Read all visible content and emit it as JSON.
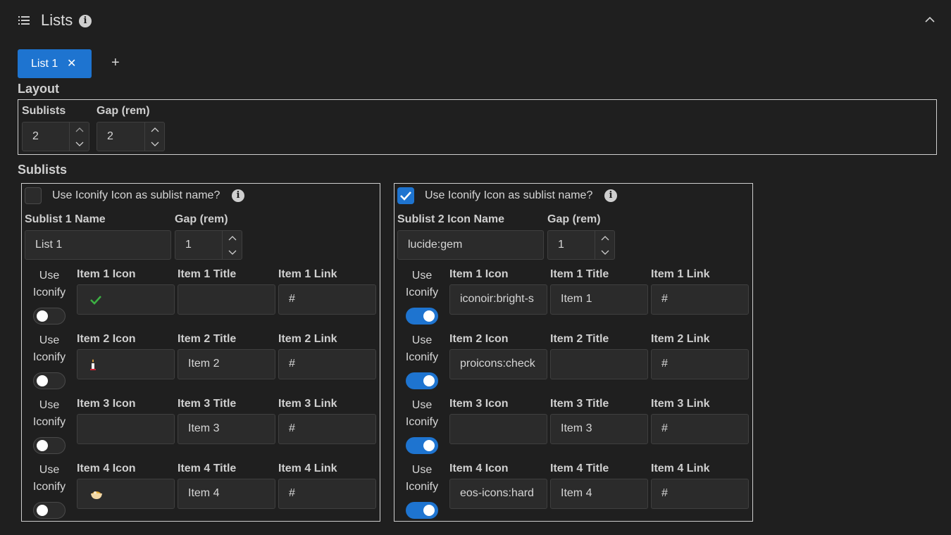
{
  "header": {
    "title": "Lists"
  },
  "tabs": [
    {
      "label": "List 1"
    }
  ],
  "layout": {
    "title": "Layout",
    "sublists_label": "Sublists",
    "sublists_value": "2",
    "gap_label": "Gap (rem)",
    "gap_value": "2"
  },
  "sublists_title": "Sublists",
  "sublists": [
    {
      "checkbox_label": "Use Iconify Icon as sublist name?",
      "checked": false,
      "name_label": "Sublist 1 Name",
      "name_value": "List 1",
      "gap_label": "Gap (rem)",
      "gap_value": "1",
      "items": [
        {
          "use_label_1": "Use",
          "use_label_2": "Iconify",
          "iconify": false,
          "icon_label": "Item 1 Icon",
          "icon_value": "",
          "icon_glyph": "check",
          "title_label": "Item 1 Title",
          "title_value": "",
          "link_label": "Item 1 Link",
          "link_value": "#"
        },
        {
          "use_label_1": "Use",
          "use_label_2": "Iconify",
          "iconify": false,
          "icon_label": "Item 2 Icon",
          "icon_value": "",
          "icon_glyph": "candle",
          "title_label": "Item 2 Title",
          "title_value": "Item 2",
          "link_label": "Item 2 Link",
          "link_value": "#"
        },
        {
          "use_label_1": "Use",
          "use_label_2": "Iconify",
          "iconify": false,
          "icon_label": "Item 3 Icon",
          "icon_value": "",
          "icon_glyph": "",
          "title_label": "Item 3 Title",
          "title_value": "Item 3",
          "link_label": "Item 3 Link",
          "link_value": "#"
        },
        {
          "use_label_1": "Use",
          "use_label_2": "Iconify",
          "iconify": false,
          "icon_label": "Item 4 Icon",
          "icon_value": "",
          "icon_glyph": "noodles",
          "title_label": "Item 4 Title",
          "title_value": "Item 4",
          "link_label": "Item 4 Link",
          "link_value": "#"
        }
      ]
    },
    {
      "checkbox_label": "Use Iconify Icon as sublist name?",
      "checked": true,
      "name_label": "Sublist 2 Icon Name",
      "name_value": "lucide:gem",
      "gap_label": "Gap (rem)",
      "gap_value": "1",
      "items": [
        {
          "use_label_1": "Use",
          "use_label_2": "Iconify",
          "iconify": true,
          "icon_label": "Item 1 Icon",
          "icon_value": "iconoir:bright-s",
          "icon_glyph": "",
          "title_label": "Item 1 Title",
          "title_value": "Item 1",
          "link_label": "Item 1 Link",
          "link_value": "#"
        },
        {
          "use_label_1": "Use",
          "use_label_2": "Iconify",
          "iconify": true,
          "icon_label": "Item 2 Icon",
          "icon_value": "proicons:check",
          "icon_glyph": "",
          "title_label": "Item 2 Title",
          "title_value": "",
          "link_label": "Item 2 Link",
          "link_value": "#"
        },
        {
          "use_label_1": "Use",
          "use_label_2": "Iconify",
          "iconify": true,
          "icon_label": "Item 3 Icon",
          "icon_value": "",
          "icon_glyph": "",
          "title_label": "Item 3 Title",
          "title_value": "Item 3",
          "link_label": "Item 3 Link",
          "link_value": "#"
        },
        {
          "use_label_1": "Use",
          "use_label_2": "Iconify",
          "iconify": true,
          "icon_label": "Item 4 Icon",
          "icon_value": "eos-icons:hard",
          "icon_glyph": "",
          "title_label": "Item 4 Title",
          "title_value": "Item 4",
          "link_label": "Item 4 Link",
          "link_value": "#"
        }
      ]
    }
  ],
  "colors": {
    "accent": "#1e74d0",
    "background": "#1f1f1f",
    "input_bg": "#2b2b2b",
    "border": "#cfcfcf"
  }
}
